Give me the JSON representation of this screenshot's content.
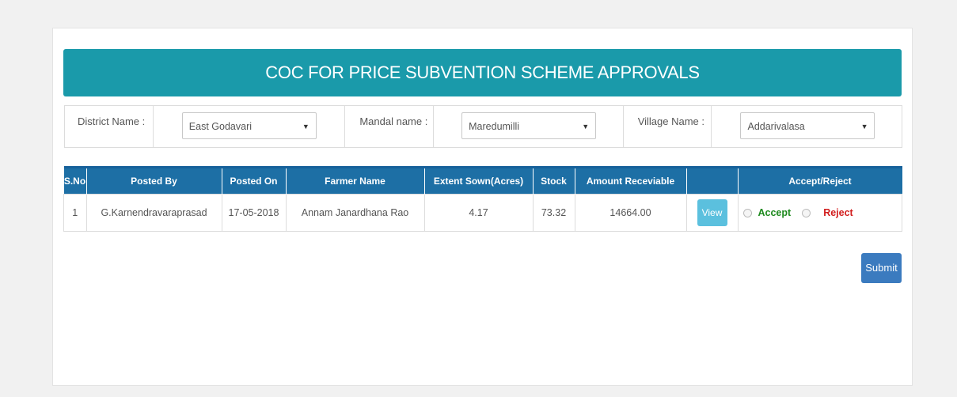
{
  "page": {
    "title": "COC FOR PRICE SUBVENTION SCHEME APPROVALS"
  },
  "filters": {
    "district_label": "District Name :",
    "district_value": "East Godavari",
    "mandal_label": "Mandal name :",
    "mandal_value": "Maredumilli",
    "village_label": "Village Name :",
    "village_value": "Addarivalasa"
  },
  "table": {
    "headers": [
      "S.No",
      "Posted By",
      "Posted On",
      "Farmer Name",
      "Extent Sown(Acres)",
      "Stock",
      "Amount Receviable",
      "",
      "Accept/Reject"
    ],
    "rows": [
      {
        "sno": "1",
        "posted_by": "G.Karnendravaraprasad",
        "posted_on": "17-05-2018",
        "farmer_name": "Annam Janardhana Rao",
        "extent_sown": "4.17",
        "stock": "73.32",
        "amount": "14664.00",
        "view_label": "View",
        "accept_label": "Accept",
        "reject_label": "Reject"
      }
    ]
  },
  "actions": {
    "submit_label": "Submit"
  }
}
